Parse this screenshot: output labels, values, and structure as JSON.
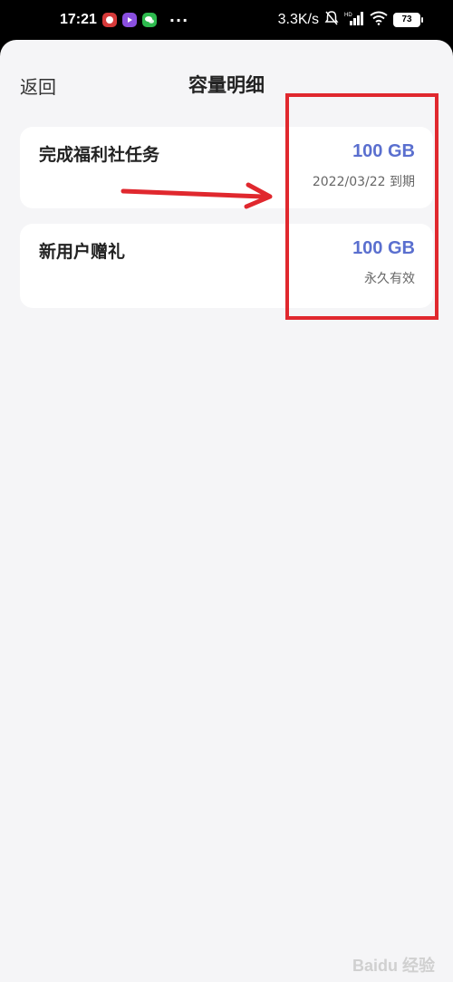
{
  "status_bar": {
    "time": "17:21",
    "more": "···",
    "net_speed": "3.3K/s",
    "battery": "73"
  },
  "header": {
    "back_label": "返回",
    "title": "容量明细"
  },
  "items": [
    {
      "title": "完成福利社任务",
      "amount": "100 GB",
      "note": "2022/03/22 到期"
    },
    {
      "title": "新用户赠礼",
      "amount": "100 GB",
      "note": "永久有效"
    }
  ],
  "watermark": "Baidu 经验",
  "colors": {
    "accent": "#5a6fcf",
    "annotation": "#e0282e",
    "background": "#f5f5f7"
  }
}
